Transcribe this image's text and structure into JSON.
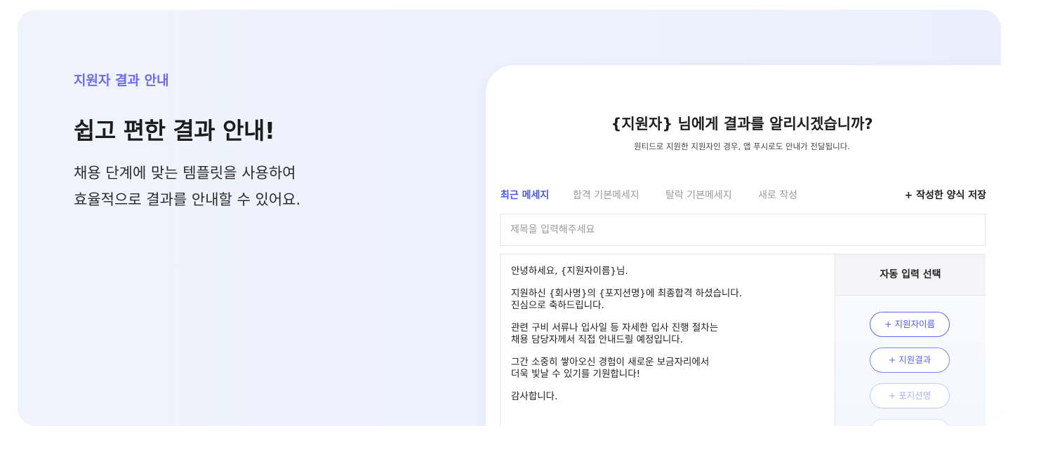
{
  "hero": {
    "eyebrow": "지원자 결과 안내",
    "headline": "쉽고 편한 결과 안내!",
    "description_lines": [
      "채용 단계에 맞는 템플릿을 사용하여",
      "효율적으로 결과를 안내할 수 있어요."
    ]
  },
  "card": {
    "title": "{지원자} 님에게 결과를 알리시겠습니까?",
    "subtitle": "원티드로 지원한 지원자인 경우, 앱 푸시로도 안내가 전달됩니다.",
    "tabs": [
      {
        "label": "최근 메세지",
        "active": true
      },
      {
        "label": "합격 기본메세지",
        "active": false
      },
      {
        "label": "탈락 기본메세지",
        "active": false
      },
      {
        "label": "새로 작성",
        "active": false
      }
    ],
    "save_template_label": "+ 작성한 양식 저장",
    "title_input": {
      "placeholder": "제목을 입력해주세요",
      "value": ""
    },
    "message_body": [
      "안녕하세요, {지원자이름}님.",
      "",
      "지원하신 {회사명}의 {포지션명}에 최종합격 하셨습니다.",
      "진심으로 축하드립니다.",
      "",
      "관련 구비 서류나 입사일 등 자세한 입사 진행 절차는",
      "채용 담당자께서 직접 안내드릴 예정입니다.",
      "",
      "그간 소중히 쌓아오신 경험이 새로운 보금자리에서",
      "더욱 빛날 수 있기를 기원합니다!",
      "",
      "감사합니다."
    ],
    "auto_input": {
      "heading": "자동 입력 선택",
      "chips": [
        "+ 지원자이름",
        "+ 지원결과",
        "+ 포지션명",
        ""
      ]
    }
  },
  "colors": {
    "accent": "#4a5ae8",
    "eyebrow": "#6b6bf0",
    "hero_background": "#eef2fd"
  }
}
